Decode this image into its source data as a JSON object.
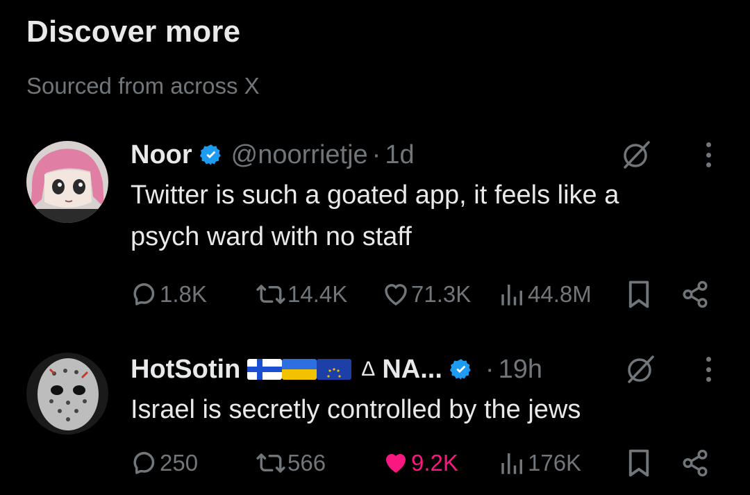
{
  "section": {
    "title": "Discover more",
    "subtitle": "Sourced from across X"
  },
  "posts": [
    {
      "name": "Noor",
      "handle": "@noorrietje",
      "dot": "·",
      "time": "1d",
      "text_lines": [
        "Twitter is such a goated app, it feels like a",
        "psych ward with no staff"
      ],
      "replies": "1.8K",
      "reposts": "14.4K",
      "likes": "71.3K",
      "views": "44.8M",
      "liked": false
    },
    {
      "name": "HotSotin",
      "name_suffix": "NA...",
      "flags": [
        "finland-flag",
        "ukraine-flag",
        "eu-flag"
      ],
      "triangle": "Δ",
      "dot": "·",
      "time": "19h",
      "text_lines": [
        "Israel is secretly controlled by the jews"
      ],
      "replies": "250",
      "reposts": "566",
      "likes": "9.2K",
      "views": "176K",
      "liked": true
    }
  ],
  "colors": {
    "background": "#000000",
    "text": "#e7e9ea",
    "muted": "#71767b",
    "verified": "#1d9bf0",
    "like": "#f91880"
  }
}
